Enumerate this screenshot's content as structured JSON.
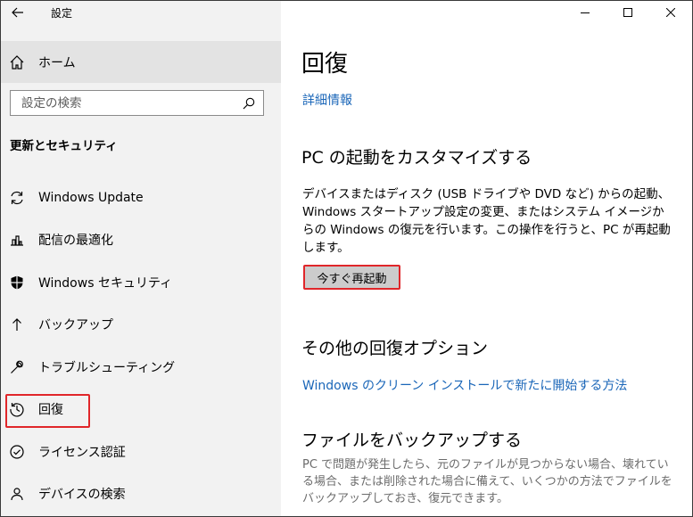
{
  "app": {
    "title": "設定"
  },
  "sidebar": {
    "home_label": "ホーム",
    "search_placeholder": "設定の検索",
    "section_title": "更新とセキュリティ",
    "items": [
      {
        "label": "Windows Update",
        "icon": "sync-icon"
      },
      {
        "label": "配信の最適化",
        "icon": "delivery-optimization-icon"
      },
      {
        "label": "Windows セキュリティ",
        "icon": "shield-icon"
      },
      {
        "label": "バックアップ",
        "icon": "backup-arrow-icon"
      },
      {
        "label": "トラブルシューティング",
        "icon": "wrench-icon"
      },
      {
        "label": "回復",
        "icon": "history-icon",
        "selected": true
      },
      {
        "label": "ライセンス認証",
        "icon": "check-circle-icon"
      },
      {
        "label": "デバイスの検索",
        "icon": "person-locate-icon"
      }
    ]
  },
  "main": {
    "title": "回復",
    "details_link": "詳細情報",
    "advanced_startup": {
      "heading": "PC の起動をカスタマイズする",
      "description": "デバイスまたはディスク (USB ドライブや DVD など) からの起動、Windows スタートアップ設定の変更、またはシステム イメージからの Windows の復元を行います。この操作を行うと、PC が再起動します。",
      "button_label": "今すぐ再起動"
    },
    "more_options": {
      "heading": "その他の回復オプション",
      "link": "Windows のクリーン インストールで新たに開始する方法"
    },
    "backup": {
      "heading": "ファイルをバックアップする",
      "description": "PC で問題が発生したら、元のファイルが見つからない場合、壊れている場合、または削除された場合に備えて、いくつかの方法でファイルをバックアップしておき、復元できます。"
    }
  },
  "colors": {
    "accent": "#1a66b8",
    "highlight": "#e0262a",
    "sidebar_bg": "#f2f2f2"
  }
}
